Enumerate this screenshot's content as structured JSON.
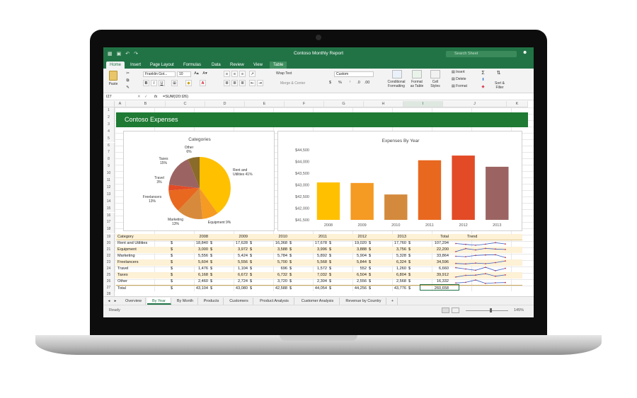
{
  "window": {
    "title": "Contoso Monthly Report",
    "search_placeholder": "Search Sheet"
  },
  "ribbon_tabs": [
    "Home",
    "Insert",
    "Page Layout",
    "Formulas",
    "Data",
    "Review",
    "View",
    "Table"
  ],
  "ribbon": {
    "paste_label": "Paste",
    "font_name": "Franklin Got...",
    "font_size": "10",
    "bold": "B",
    "italic": "I",
    "underline": "U",
    "wrap_text": "Wrap Text",
    "merge_center": "Merge & Center",
    "number_format": "Custom",
    "conditional_formatting": "Conditional Formatting",
    "format_as_table": "Format as Table",
    "cell_styles": "Cell Styles",
    "insert": "Insert",
    "delete": "Delete",
    "format": "Format",
    "sort_filter": "Sort & Filter"
  },
  "formula_bar": {
    "cell_ref": "I27",
    "fx": "fx",
    "formula": "=SUM(I20:I26)"
  },
  "columns": [
    "A",
    "B",
    "C",
    "D",
    "E",
    "F",
    "G",
    "H",
    "I",
    "J",
    "K"
  ],
  "selected_column": "I",
  "rows": [
    "1",
    "2",
    "3",
    "4",
    "5",
    "6",
    "7",
    "8",
    "9",
    "10",
    "11",
    "12",
    "13",
    "14",
    "15",
    "16",
    "17",
    "18",
    "19",
    "20",
    "21",
    "22",
    "23",
    "24",
    "25",
    "26",
    "27",
    "28"
  ],
  "banner_title": "Contoso Expenses",
  "pie_chart": {
    "title": "Categories",
    "labels": [
      {
        "name": "Rent and Utilities",
        "pct": "41%"
      },
      {
        "name": "Equipment",
        "pct": "9%"
      },
      {
        "name": "Marketing",
        "pct": "13%"
      },
      {
        "name": "Freelancers",
        "pct": "13%"
      },
      {
        "name": "Travel",
        "pct": "3%"
      },
      {
        "name": "Taxes",
        "pct": "15%"
      },
      {
        "name": "Other",
        "pct": "6%"
      }
    ]
  },
  "chart_data": {
    "type": "bar",
    "title": "Expenses By Year",
    "categories": [
      "2008",
      "2009",
      "2010",
      "2011",
      "2012",
      "2013"
    ],
    "values": [
      43104,
      43080,
      42588,
      44054,
      44256,
      43776
    ],
    "colors": [
      "#ffc000",
      "#f59a23",
      "#d48a3c",
      "#e8681f",
      "#e24b26",
      "#9b6462"
    ],
    "y_ticks": [
      "$44,500",
      "$44,000",
      "$43,500",
      "$43,000",
      "$42,500",
      "$42,000",
      "$41,500"
    ],
    "ylim": [
      41500,
      44500
    ],
    "grid": false
  },
  "table": {
    "header": [
      "Category",
      "2008",
      "2009",
      "2010",
      "2011",
      "2012",
      "2013",
      "Total",
      "Trend"
    ],
    "currency": "$",
    "rows": [
      {
        "cat": "Rent and Utilities",
        "v": [
          "18,840",
          "17,628",
          "16,368",
          "17,678",
          "19,020",
          "17,760",
          "107,294"
        ],
        "trend": [
          0.5,
          0.3,
          0.1,
          0.35,
          0.7,
          0.4
        ]
      },
      {
        "cat": "Equipment",
        "v": [
          "3,000",
          "3,972",
          "3,588",
          "3,996",
          "3,888",
          "3,756",
          "22,200"
        ],
        "trend": [
          0.1,
          0.8,
          0.5,
          0.85,
          0.7,
          0.6
        ]
      },
      {
        "cat": "Marketing",
        "v": [
          "5,556",
          "5,424",
          "5,784",
          "5,892",
          "5,904",
          "5,328",
          "33,864"
        ],
        "trend": [
          0.5,
          0.4,
          0.7,
          0.8,
          0.85,
          0.2
        ]
      },
      {
        "cat": "Freelancers",
        "v": [
          "5,604",
          "5,556",
          "5,700",
          "5,568",
          "5,844",
          "6,324",
          "34,596"
        ],
        "trend": [
          0.3,
          0.2,
          0.4,
          0.25,
          0.5,
          0.9
        ]
      },
      {
        "cat": "Travel",
        "v": [
          "1,476",
          "1,104",
          "696",
          "1,572",
          "552",
          "1,260",
          "6,660"
        ],
        "trend": [
          0.8,
          0.5,
          0.2,
          0.9,
          0.1,
          0.65
        ]
      },
      {
        "cat": "Taxes",
        "v": [
          "6,168",
          "6,672",
          "6,732",
          "7,032",
          "6,504",
          "6,804",
          "39,912"
        ],
        "trend": [
          0.1,
          0.5,
          0.55,
          0.9,
          0.3,
          0.6
        ]
      },
      {
        "cat": "Other",
        "v": [
          "2,460",
          "2,724",
          "3,720",
          "2,304",
          "2,556",
          "2,568",
          "16,332"
        ],
        "trend": [
          0.2,
          0.35,
          0.9,
          0.1,
          0.25,
          0.3
        ]
      }
    ],
    "total": {
      "cat": "Total",
      "v": [
        "43,104",
        "43,080",
        "42,588",
        "44,054",
        "44,256",
        "43,776",
        "260,658"
      ]
    }
  },
  "sheet_tabs": [
    "Overview",
    "By Year",
    "By Month",
    "Products",
    "Customers",
    "Product Analysis",
    "Customer Analysis",
    "Revenue by Country",
    "+"
  ],
  "active_sheet": "By Year",
  "status": {
    "ready": "Ready",
    "zoom": "145%"
  }
}
